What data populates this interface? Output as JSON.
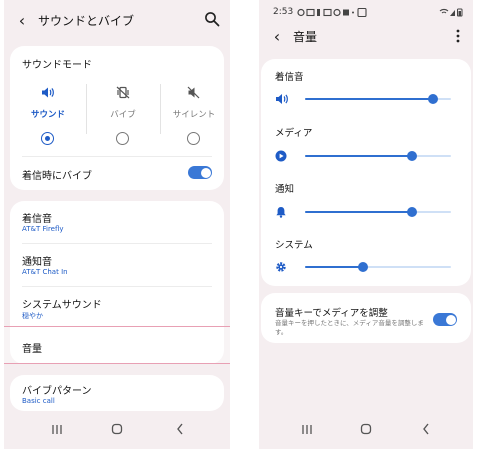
{
  "left": {
    "header": {
      "title": "サウンドとバイブ"
    },
    "sound_mode": {
      "title": "サウンドモード",
      "options": [
        {
          "label": "サウンド",
          "icon": "volume-icon",
          "selected": true
        },
        {
          "label": "バイブ",
          "icon": "vibrate-icon",
          "selected": false
        },
        {
          "label": "サイレント",
          "icon": "mute-icon",
          "selected": false
        }
      ],
      "vibrate_on_ring": {
        "label": "着信時にバイブ",
        "on": true
      }
    },
    "settings": [
      {
        "title": "着信音",
        "subtitle": "AT&T Firefly"
      },
      {
        "title": "通知音",
        "subtitle": "AT&T Chat In"
      },
      {
        "title": "システムサウンド",
        "subtitle": "穏やか"
      },
      {
        "title": "音量",
        "subtitle": ""
      }
    ],
    "vibration_pattern": {
      "title": "バイブパターン",
      "subtitle": "Basic call"
    }
  },
  "right": {
    "status": {
      "time": "2:53"
    },
    "header": {
      "title": "音量"
    },
    "volumes": [
      {
        "label": "着信音",
        "icon": "volume-icon",
        "level": 0.88
      },
      {
        "label": "メディア",
        "icon": "play-icon",
        "level": 0.73
      },
      {
        "label": "通知",
        "icon": "bell-icon",
        "level": 0.73
      },
      {
        "label": "システム",
        "icon": "gear-icon",
        "level": 0.4
      }
    ],
    "volume_keys": {
      "title": "音量キーでメディアを調整",
      "description": "音量キーを押したときに、メディア音量を調整します。",
      "on": true
    }
  },
  "colors": {
    "accent": "#2f6fd0",
    "background": "#f5eef0",
    "highlight": "#e8a0b4"
  }
}
